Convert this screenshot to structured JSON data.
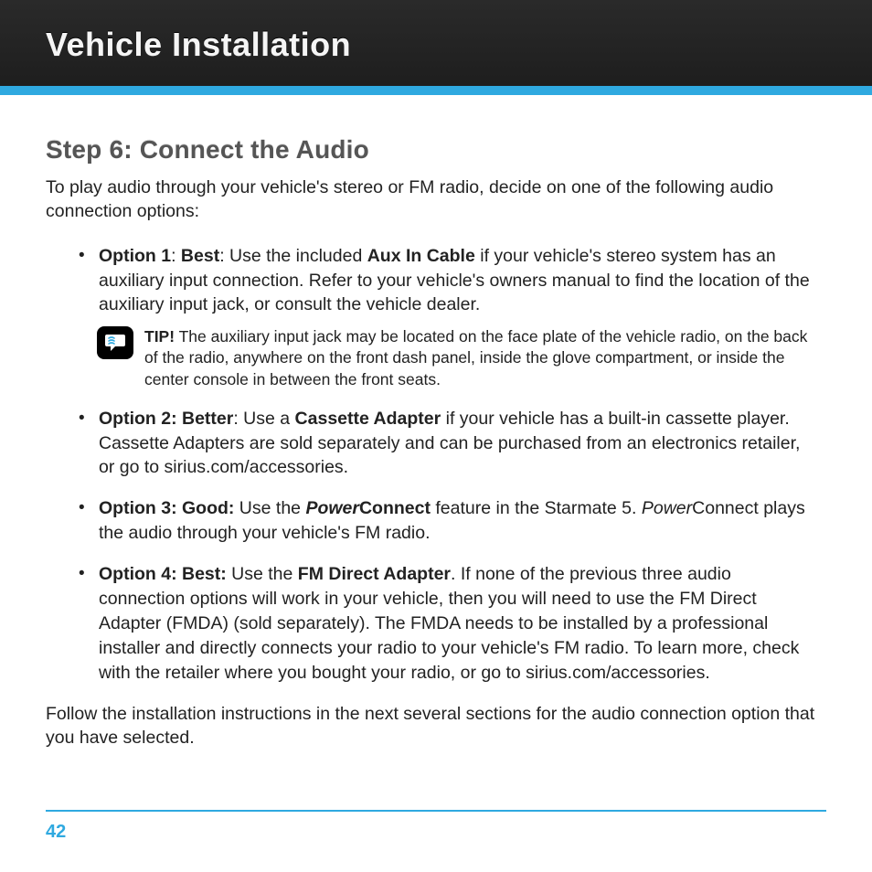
{
  "header": {
    "title": "Vehicle Installation"
  },
  "step": {
    "title": "Step 6: Connect the Audio",
    "intro": "To play audio through your vehicle's stereo or FM radio, decide on one of the following audio connection options:"
  },
  "options": {
    "opt1": {
      "label": "Option 1",
      "rank": "Best",
      "pre": ": Use the included ",
      "product": "Aux In Cable",
      "post": " if your vehicle's stereo system has an auxiliary input connection. Refer to your vehicle's owners manual to find the location of the auxiliary input jack, or consult the vehicle dealer."
    },
    "tip": {
      "label": "TIP!",
      "text": " The auxiliary input jack may be located on the face plate of the vehicle radio, on the back of the radio, anywhere on the front dash panel, inside the glove compartment, or inside the center console in between the front seats."
    },
    "opt2": {
      "label": "Option 2: Better",
      "pre": ": Use a ",
      "product": "Cassette Adapter",
      "post": " if your vehicle has a built-in cassette player. Cassette Adapters are sold separately and can be purchased from an electronics retailer, or go to sirius.com/accessories."
    },
    "opt3": {
      "label": "Option 3: Good:",
      "pre": " Use the ",
      "brand_i": "Power",
      "brand_b": "Connect",
      "mid": " feature in the Starmate 5. ",
      "brand2_i": "Power",
      "brand2_r": "Connect plays the audio through your vehicle's FM radio."
    },
    "opt4": {
      "label": "Option 4: Best:",
      "pre": " Use the ",
      "product": "FM Direct Adapter",
      "post": ". If none of the previous three audio connection options will work in your vehicle, then you will need to use the FM Direct Adapter (FMDA) (sold separately). The FMDA needs to be installed by a professional installer and directly connects your radio to your vehicle's FM radio. To learn more, check with the retailer where you bought your radio, or go to sirius.com/accessories."
    }
  },
  "follow": "Follow the installation instructions in the next several sections for the audio connection option that you have selected.",
  "page_number": "42",
  "colors": {
    "accent": "#2fa9e0"
  }
}
